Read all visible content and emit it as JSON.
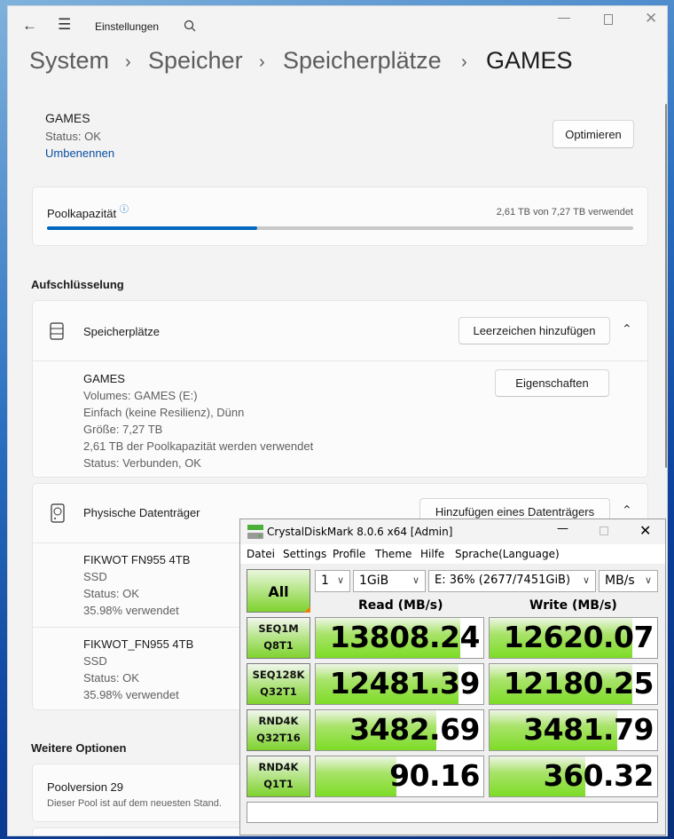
{
  "settings": {
    "app_title": "Einstellungen",
    "breadcrumb": [
      "System",
      "Speicher",
      "Speicherplätze",
      "GAMES"
    ],
    "pool": {
      "name": "GAMES",
      "status": "Status: OK",
      "rename": "Umbenennen",
      "optimize": "Optimieren"
    },
    "capacity": {
      "label": "Poolkapazität",
      "usage_text": "2,61 TB von 7,27 TB verwendet",
      "used_fraction": 0.359
    },
    "breakdown_heading": "Aufschlüsselung",
    "spaces": {
      "title": "Speicherplätze",
      "add_button": "Leerzeichen hinzufügen",
      "item": {
        "name": "GAMES",
        "lines": [
          "Volumes: GAMES (E:)",
          "Einfach (keine Resilienz), Dünn",
          "Größe: 7,27 TB",
          "2,61 TB der Poolkapazität werden verwendet",
          "Status: Verbunden, OK"
        ],
        "properties": "Eigenschaften"
      }
    },
    "disks": {
      "title": "Physische Datenträger",
      "add_button": "Hinzufügen eines Datenträgers",
      "items": [
        {
          "name": "FIKWOT FN955 4TB",
          "type": "SSD",
          "status": "Status: OK",
          "used": "35.98% verwendet"
        },
        {
          "name": "FIKWOT_FN955 4TB",
          "type": "SSD",
          "status": "Status: OK",
          "used": "35.98% verwendet"
        }
      ]
    },
    "more_heading": "Weitere Optionen",
    "pool_version": {
      "title": "Poolversion 29",
      "desc": "Dieser Pool ist auf dem neuesten Stand."
    },
    "accent": "#0067c0"
  },
  "cdm": {
    "title": "CrystalDiskMark 8.0.6 x64 [Admin]",
    "menu": [
      "Datei",
      "Settings",
      "Profile",
      "Theme",
      "Hilfe",
      "Sprache(Language)"
    ],
    "all_button": "All",
    "count": "1",
    "size": "1GiB",
    "drive": "E: 36% (2677/7451GiB)",
    "unit": "MB/s",
    "read_header": "Read (MB/s)",
    "write_header": "Write (MB/s)",
    "rows": [
      {
        "l1": "SEQ1M",
        "l2": "Q8T1",
        "read": "13808.24",
        "write": "12620.07",
        "read_fill": 0.86,
        "write_fill": 0.85
      },
      {
        "l1": "SEQ128K",
        "l2": "Q32T1",
        "read": "12481.39",
        "write": "12180.25",
        "read_fill": 0.85,
        "write_fill": 0.85
      },
      {
        "l1": "RND4K",
        "l2": "Q32T16",
        "read": "3482.69",
        "write": "3481.79",
        "read_fill": 0.72,
        "write_fill": 0.76
      },
      {
        "l1": "RND4K",
        "l2": "Q1T1",
        "read": "90.16",
        "write": "360.32",
        "read_fill": 0.48,
        "write_fill": 0.57
      }
    ]
  }
}
